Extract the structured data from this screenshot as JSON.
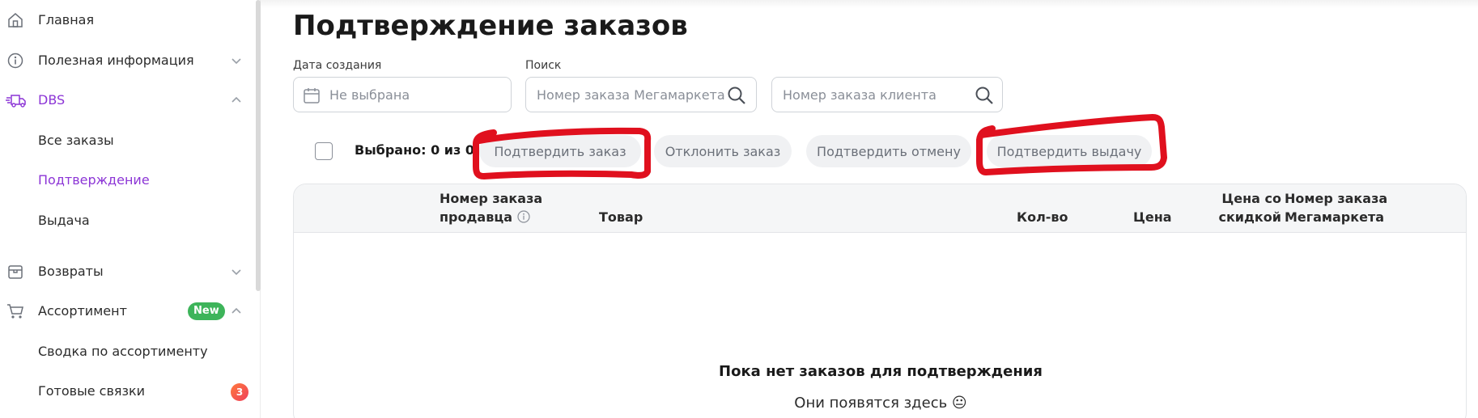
{
  "sidebar": {
    "items": [
      {
        "label": "Главная",
        "icon": "home-icon"
      },
      {
        "label": "Полезная информация",
        "icon": "info-circle-icon"
      },
      {
        "label": "DBS",
        "icon": "delivery-truck-icon"
      },
      {
        "label": "Все заказы"
      },
      {
        "label": "Подтверждение"
      },
      {
        "label": "Выдача"
      },
      {
        "label": "Возвраты",
        "icon": "box-icon"
      },
      {
        "label": "Ассортимент",
        "icon": "cart-icon",
        "badge": "New"
      },
      {
        "label": "Сводка по ассортименту"
      },
      {
        "label": "Готовые связки",
        "badge": "3"
      }
    ]
  },
  "page": {
    "title": "Подтверждение заказов"
  },
  "filters": {
    "date_label": "Дата создания",
    "date_placeholder": "Не выбрана",
    "search_label": "Поиск",
    "search_marketplace_placeholder": "Номер заказа Мегамаркета",
    "search_client_placeholder": "Номер заказа клиента"
  },
  "actions": {
    "selected_text": "Выбрано: 0 из 0",
    "confirm_order": "Подтвердить заказ",
    "reject_order": "Отклонить заказ",
    "confirm_cancel": "Подтвердить отмену",
    "confirm_pickup": "Подтвердить выдачу"
  },
  "table": {
    "columns": {
      "seller_order_line1": "Номер заказа",
      "seller_order_line2": "продавца",
      "product": "Товар",
      "qty": "Кол-во",
      "price": "Цена",
      "discount_line1": "Цена со",
      "discount_line2": "скидкой",
      "mm_order_line1": "Номер заказа",
      "mm_order_line2": "Мегамаркета"
    },
    "empty_title": "Пока нет заказов для подтверждения",
    "empty_subtitle": "Они появятся здесь 😐"
  },
  "colors": {
    "accent": "#8c35d6",
    "new_badge": "#3db45a",
    "count_badge": "#f25c3b",
    "annotation": "#e0101e"
  }
}
